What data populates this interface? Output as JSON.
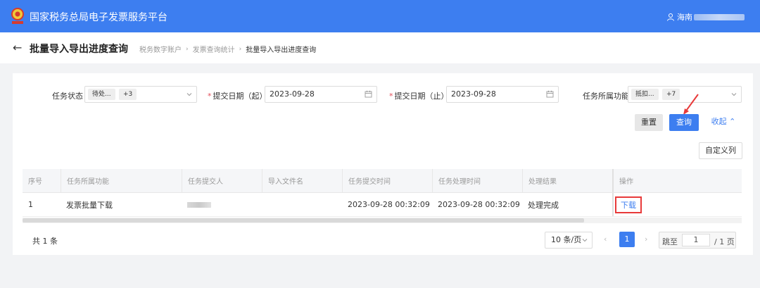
{
  "app": {
    "title": "国家税务总局电子发票服务平台",
    "user": "海南"
  },
  "header": {
    "page_title": "批量导入导出进度查询",
    "breadcrumbs": [
      "税务数字账户",
      "发票查询统计",
      "批量导入导出进度查询"
    ]
  },
  "filters": {
    "status": {
      "label": "任务状态",
      "tag": "待处...",
      "more": "+3"
    },
    "date_start": {
      "label": "提交日期（起）",
      "value": "2023-09-28"
    },
    "date_end": {
      "label": "提交日期（止）",
      "value": "2023-09-28"
    },
    "function": {
      "label": "任务所属功能",
      "tag": "抵扣...",
      "more": "+7"
    }
  },
  "buttons": {
    "reset": "重置",
    "query": "查询",
    "collapse": "收起",
    "custom_columns": "自定义列"
  },
  "table": {
    "columns": [
      "序号",
      "任务所属功能",
      "任务提交人",
      "导入文件名",
      "任务提交时间",
      "任务处理时间",
      "处理结果",
      "操作"
    ],
    "rows": [
      {
        "index": "1",
        "function": "发票批量下载",
        "submitter": "",
        "filename": "",
        "submit_time": "2023-09-28 00:32:09",
        "process_time": "2023-09-28 00:32:09",
        "result": "处理完成",
        "action": "下载"
      }
    ]
  },
  "pagination": {
    "total": "共 1 条",
    "page_size": "10 条/页",
    "current_page": "1",
    "jump_label": "跳至",
    "jump_value": "1",
    "page_count": "/ 1 页"
  },
  "colors": {
    "primary": "#3d7ef0",
    "highlight": "#e83a3a"
  }
}
